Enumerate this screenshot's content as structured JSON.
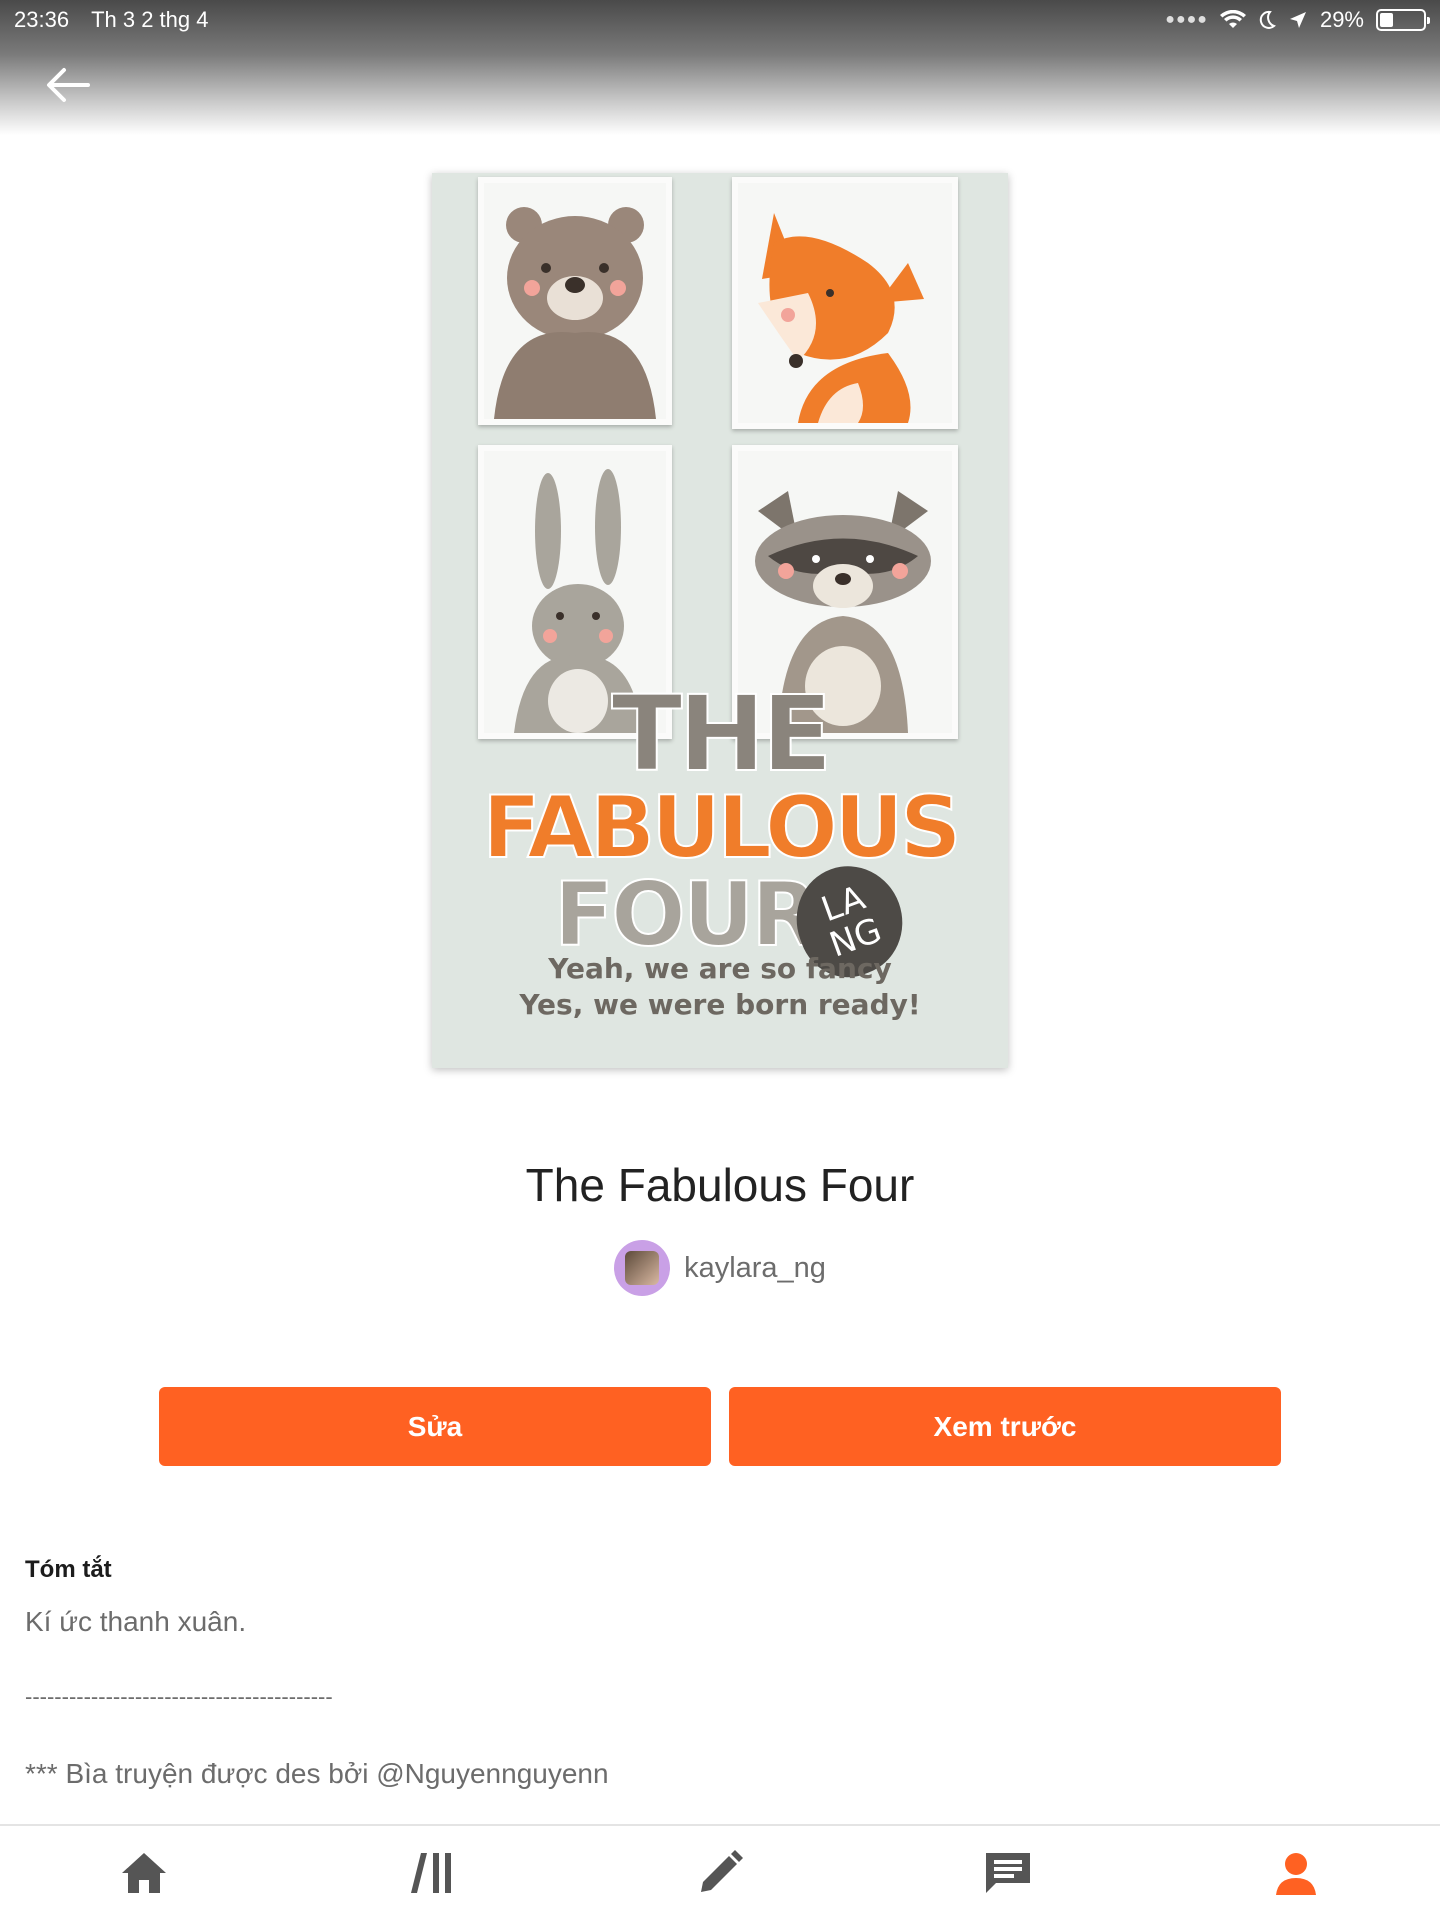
{
  "status_bar": {
    "time": "23:36",
    "date": "Th 3 2 thg 4",
    "battery_percent": "29%"
  },
  "header": {
    "back_icon": "arrow-left-icon"
  },
  "cover": {
    "title_line1": "THE",
    "title_line2": "FABULOUS",
    "title_line3": "FOUR",
    "badge_line1": "LA",
    "badge_line2": "NG",
    "tagline1": "Yeah, we are so fancy",
    "tagline2": "Yes, we were born ready!"
  },
  "story": {
    "title": "The Fabulous Four",
    "author": "kaylara_ng"
  },
  "actions": {
    "edit_label": "Sửa",
    "preview_label": "Xem trước"
  },
  "summary": {
    "label": "Tóm tắt",
    "line1": "Kí ức thanh xuân.",
    "divider": "------------------------------------------",
    "line2": "*** Bìa truyện được des bởi @Nguyennguyenn"
  },
  "tabs": [
    {
      "icon": "home-icon"
    },
    {
      "icon": "library-icon"
    },
    {
      "icon": "write-icon"
    },
    {
      "icon": "messages-icon"
    },
    {
      "icon": "profile-icon"
    }
  ],
  "colors": {
    "accent": "#ff6122",
    "active_tab": "#ff6122",
    "inactive_tab": "#555555"
  }
}
